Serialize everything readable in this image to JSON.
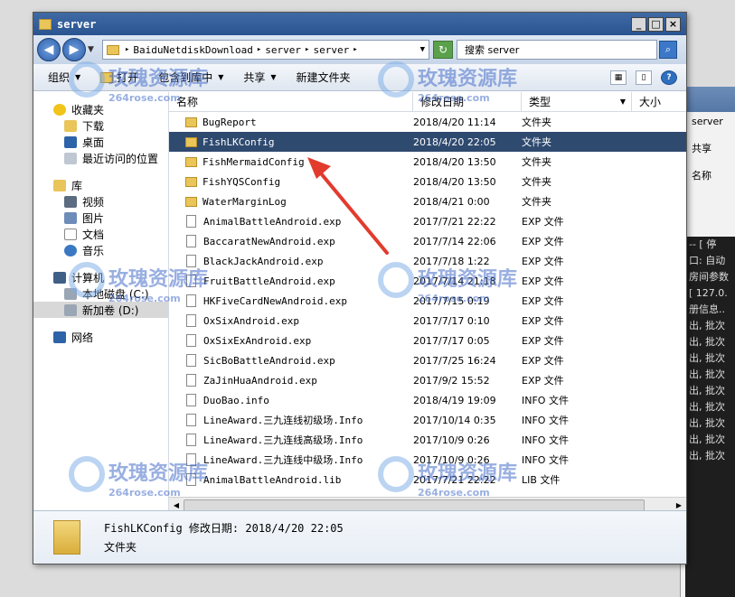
{
  "window": {
    "title": "server"
  },
  "address": {
    "crumbs": [
      "BaiduNetdiskDownload",
      "server",
      "server"
    ]
  },
  "search": {
    "placeholder": "搜索 server"
  },
  "toolbar": {
    "organize": "组织",
    "open": "打开",
    "include": "包含到库中",
    "share": "共享",
    "new_folder": "新建文件夹"
  },
  "nav": {
    "favorites": "收藏夹",
    "downloads": "下载",
    "desktop": "桌面",
    "recent": "最近访问的位置",
    "libraries": "库",
    "videos": "视频",
    "pictures": "图片",
    "documents": "文档",
    "music": "音乐",
    "computer": "计算机",
    "drive_c": "本地磁盘 (C:)",
    "drive_d": "新加卷 (D:)",
    "network": "网络"
  },
  "columns": {
    "name": "名称",
    "date": "修改日期",
    "type": "类型",
    "size": "大小"
  },
  "files": [
    {
      "name": "BugReport",
      "date": "2018/4/20 11:14",
      "type": "文件夹",
      "kind": "folder"
    },
    {
      "name": "FishLKConfig",
      "date": "2018/4/20 22:05",
      "type": "文件夹",
      "kind": "folder",
      "selected": true
    },
    {
      "name": "FishMermaidConfig",
      "date": "2018/4/20 13:50",
      "type": "文件夹",
      "kind": "folder"
    },
    {
      "name": "FishYQSConfig",
      "date": "2018/4/20 13:50",
      "type": "文件夹",
      "kind": "folder"
    },
    {
      "name": "WaterMarginLog",
      "date": "2018/4/21 0:00",
      "type": "文件夹",
      "kind": "folder"
    },
    {
      "name": "AnimalBattleAndroid.exp",
      "date": "2017/7/21 22:22",
      "type": "EXP 文件",
      "kind": "file"
    },
    {
      "name": "BaccaratNewAndroid.exp",
      "date": "2017/7/14 22:06",
      "type": "EXP 文件",
      "kind": "file"
    },
    {
      "name": "BlackJackAndroid.exp",
      "date": "2017/7/18 1:22",
      "type": "EXP 文件",
      "kind": "file"
    },
    {
      "name": "FruitBattleAndroid.exp",
      "date": "2017/7/14 21:18",
      "type": "EXP 文件",
      "kind": "file"
    },
    {
      "name": "HKFiveCardNewAndroid.exp",
      "date": "2017/7/15 0:19",
      "type": "EXP 文件",
      "kind": "file"
    },
    {
      "name": "OxSixAndroid.exp",
      "date": "2017/7/17 0:10",
      "type": "EXP 文件",
      "kind": "file"
    },
    {
      "name": "OxSixExAndroid.exp",
      "date": "2017/7/17 0:05",
      "type": "EXP 文件",
      "kind": "file"
    },
    {
      "name": "SicBoBattleAndroid.exp",
      "date": "2017/7/25 16:24",
      "type": "EXP 文件",
      "kind": "file"
    },
    {
      "name": "ZaJinHuaAndroid.exp",
      "date": "2017/9/2 15:52",
      "type": "EXP 文件",
      "kind": "file"
    },
    {
      "name": "DuoBao.info",
      "date": "2018/4/19 19:09",
      "type": "INFO 文件",
      "kind": "file"
    },
    {
      "name": "LineAward.三九连线初级场.Info",
      "date": "2017/10/14 0:35",
      "type": "INFO 文件",
      "kind": "file"
    },
    {
      "name": "LineAward.三九连线高级场.Info",
      "date": "2017/10/9 0:26",
      "type": "INFO 文件",
      "kind": "file"
    },
    {
      "name": "LineAward.三九连线中级场.Info",
      "date": "2017/10/9 0:26",
      "type": "INFO 文件",
      "kind": "file"
    },
    {
      "name": "AnimalBattleAndroid.lib",
      "date": "2017/7/21 22:22",
      "type": "LIB 文件",
      "kind": "file"
    }
  ],
  "details": {
    "line1": "FishLKConfig 修改日期: 2018/4/20 22:05",
    "line2": "文件夹"
  },
  "watermark": {
    "text": "玫瑰资源库",
    "sub": "264rose.com"
  },
  "background_window": {
    "rows": [
      "server",
      "共享",
      "名称"
    ],
    "console": [
      "-- [ 停",
      "口: 自动",
      "房间参数",
      "[ 127.0.",
      "册信息..",
      "出, 批次",
      "出, 批次",
      "出, 批次",
      "出, 批次",
      "出, 批次",
      "出, 批次",
      "出, 批次",
      "出, 批次",
      "出, 批次"
    ]
  }
}
